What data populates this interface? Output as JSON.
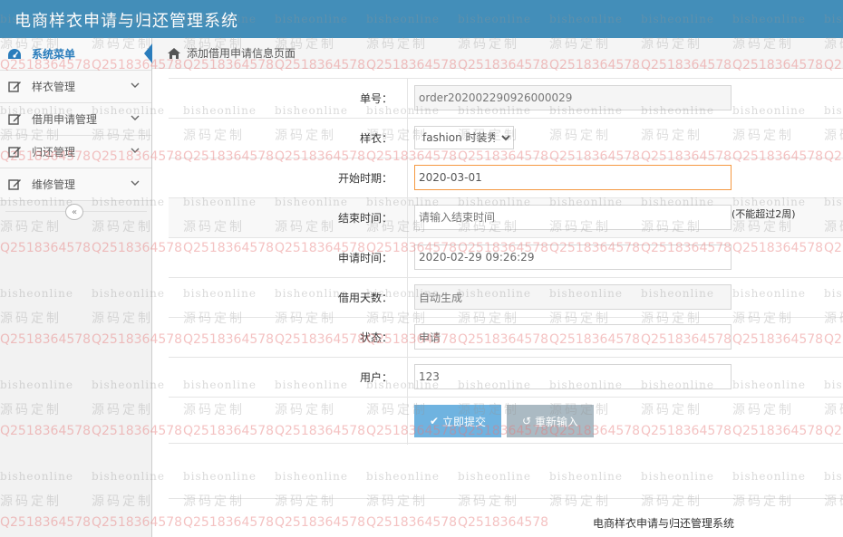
{
  "app": {
    "title": "电商样衣申请与归还管理系统"
  },
  "sidebar": {
    "menu_label": "系统菜单",
    "items": [
      {
        "label": "样衣管理"
      },
      {
        "label": "借用申请管理"
      },
      {
        "label": "归还管理"
      },
      {
        "label": "维修管理"
      }
    ]
  },
  "breadcrumb": {
    "text": "添加借用申请信息页面"
  },
  "form": {
    "order_no": {
      "label": "单号：",
      "value": "order202002290926000029"
    },
    "sample": {
      "label": "样衣：",
      "value": "fashion 时装秀"
    },
    "start_date": {
      "label": "开始时期：",
      "value": "2020-03-01"
    },
    "end_time": {
      "label": "结束时间：",
      "placeholder": "请输入结束时间",
      "hint": "(不能超过2周)"
    },
    "apply_time": {
      "label": "申请时间：",
      "value": "2020-02-29 09:26:29"
    },
    "borrow_days": {
      "label": "借用天数：",
      "value": "自动生成"
    },
    "status": {
      "label": "状态：",
      "value": "申请"
    },
    "user": {
      "label": "用户：",
      "value": "123"
    },
    "submit_label": "立即提交",
    "reset_label": "重新输入"
  },
  "footer": {
    "text": "电商样衣申请与归还管理系统"
  },
  "watermark": {
    "line1": "bisheonline",
    "line2": "源码定制",
    "line3": "Q2518364578"
  },
  "colors": {
    "topbar": "#438eb9",
    "accent": "#2b7dbc",
    "submit": "#6fb3e0",
    "reset": "#abbac3",
    "focus": "#f59942"
  },
  "icons": {
    "menu": "dashboard-icon",
    "item": "edit-icon",
    "chevron": "chevron-down-icon",
    "home": "home-icon",
    "collapse": "double-chevron-left-icon",
    "submit": "check-icon",
    "reset": "undo-icon"
  }
}
